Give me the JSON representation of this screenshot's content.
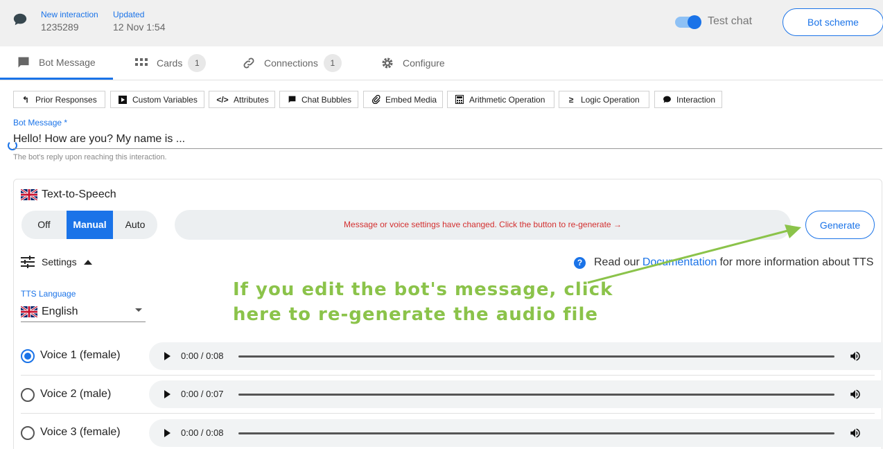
{
  "header": {
    "interaction_label": "New interaction",
    "interaction_id": "1235289",
    "updated_label": "Updated",
    "updated_value": "12 Nov 1:54",
    "test_chat_label": "Test chat",
    "test_chat_enabled": true,
    "bot_scheme_label": "Bot scheme"
  },
  "tabs": [
    {
      "label": "Bot Message",
      "icon": "chat-bubble-icon",
      "active": true
    },
    {
      "label": "Cards",
      "icon": "grid-icon",
      "badge": "1"
    },
    {
      "label": "Connections",
      "icon": "link-icon",
      "badge": "1"
    },
    {
      "label": "Configure",
      "icon": "gear-icon"
    }
  ],
  "toolbar": [
    {
      "label": "Prior Responses",
      "icon": "reply-icon"
    },
    {
      "label": "Custom Variables",
      "icon": "play-box-icon"
    },
    {
      "label": "Attributes",
      "icon": "code-icon"
    },
    {
      "label": "Chat Bubbles",
      "icon": "chat-bubble-icon"
    },
    {
      "label": "Embed Media",
      "icon": "paperclip-icon"
    },
    {
      "label": "Arithmetic Operation",
      "icon": "calculator-icon"
    },
    {
      "label": "Logic Operation",
      "icon": "logic-icon"
    },
    {
      "label": "Interaction",
      "icon": "comment-icon"
    }
  ],
  "message": {
    "label": "Bot Message *",
    "value": "Hello! How are you? My name is ...",
    "help": "The bot's reply upon reaching this interaction."
  },
  "tts": {
    "title": "Text-to-Speech",
    "modes": [
      "Off",
      "Manual",
      "Auto"
    ],
    "selected_mode": "Manual",
    "status": "Message or voice settings have changed. Click the button to re-generate →",
    "generate_label": "Generate",
    "settings_label": "Settings",
    "doc_prefix": "Read our",
    "doc_link": "Documentation",
    "doc_suffix": "for more information about TTS",
    "language_label": "TTS Language",
    "language_value": "English",
    "voices": [
      {
        "label": "Voice 1 (female)",
        "time": "0:00 / 0:08",
        "selected": true
      },
      {
        "label": "Voice 2 (male)",
        "time": "0:00 / 0:07",
        "selected": false
      },
      {
        "label": "Voice 3 (female)",
        "time": "0:00 / 0:08",
        "selected": false
      }
    ]
  },
  "annotation": {
    "line1": "If you edit the bot's message, click",
    "line2": "here to re-generate the audio file",
    "color": "#8bc34a"
  },
  "colors": {
    "accent": "#1a73e8",
    "warning": "#d32f2f"
  }
}
